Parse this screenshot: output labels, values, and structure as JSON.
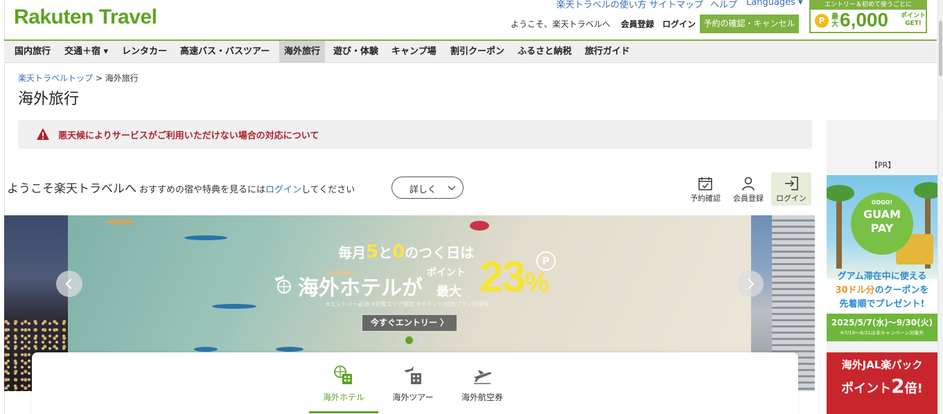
{
  "header": {
    "logo": "Rakuten Travel",
    "top_links": [
      "楽天トラベルの使い方",
      "サイトマップ",
      "ヘルプ",
      "Languages ▾"
    ],
    "welcome": "ようこそ、楽天トラベルへ",
    "signup": "会員登録",
    "login": "ログイン",
    "booking_button": "予約の確認・キャンセル",
    "promo": {
      "headline": "エントリー＆初めて使うごとに",
      "coin": "P",
      "max": "最大",
      "amount": "6,000",
      "unit_line1": "ポイント",
      "unit_line2": "GET!"
    }
  },
  "nav": {
    "items": [
      {
        "label": "国内旅行"
      },
      {
        "label": "交通＋宿 ▾"
      },
      {
        "label": "レンタカー"
      },
      {
        "label": "高速バス・バスツアー"
      },
      {
        "label": "海外旅行"
      },
      {
        "label": "遊び・体験"
      },
      {
        "label": "キャンプ場"
      },
      {
        "label": "割引クーポン"
      },
      {
        "label": "ふるさと納税"
      },
      {
        "label": "旅行ガイド"
      }
    ],
    "active": "海外旅行"
  },
  "breadcrumb": {
    "top": "楽天トラベルトップ",
    "sep": " > ",
    "current": "海外旅行"
  },
  "page_title": "海外旅行",
  "alert": {
    "text": "悪天候によりサービスがご利用いただけない場合の対応について"
  },
  "welcome_row": {
    "big": "ようこそ楽天トラベルへ",
    "small": "おすすめの宿や特典を見るには",
    "login_link": "ログイン",
    "tail": "してください",
    "detail_button": "詳しく"
  },
  "account_actions": {
    "booking": "予約確認",
    "signup": "会員登録",
    "login": "ログイン"
  },
  "hero": {
    "line1_a": "毎月",
    "line1_5": "5",
    "line1_b": "と",
    "line1_0": "0",
    "line1_c": "のつく日は",
    "line2": "海外ホテルが",
    "points": "ポイント",
    "max": "最大",
    "pct": "23",
    "pct_sign": "%",
    "p_mark": "P",
    "note": "※エントリー必須 ※対象エリア限定 ※ポイント20倍プラン利用時",
    "cta": "今すぐエントリー 〉"
  },
  "search_tabs": [
    {
      "label": "海外ホテル"
    },
    {
      "label": "海外ツアー"
    },
    {
      "label": "海外航空券"
    }
  ],
  "right_ads": {
    "pr_label": "【PR】",
    "ad1": {
      "badge_top": "GOGO!",
      "badge_mid": "GUAM",
      "badge_bot": "PAY",
      "text1": "グアム滞在中に使える",
      "text2_a": "30ドル分",
      "text2_b": "のクーポンを",
      "text3": "先着順でプレゼント!",
      "period": "2025/5/7(水)～9/30(火)",
      "period_note": "※7/19～8/31は本キャンペーン対象外"
    },
    "ad2": {
      "line1": "海外JAL楽パック",
      "line2_a": "ポイント",
      "line2_b": "2",
      "line2_c": "倍!"
    }
  },
  "colors": {
    "brand_green": "#5ea324",
    "alert_red": "#b0202a",
    "link_blue": "#3a6fb3",
    "hero_yellow": "#f5e437"
  }
}
